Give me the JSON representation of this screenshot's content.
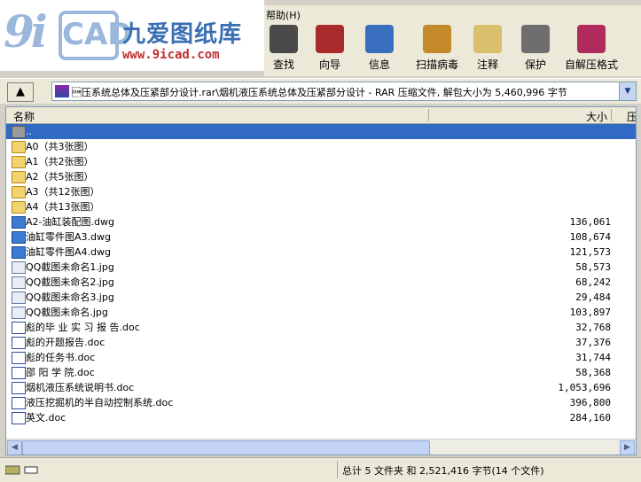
{
  "menu": {
    "help": "帮助(H)"
  },
  "logo": {
    "big": "9i",
    "cad": "CAD",
    "cn": "九爱图纸库",
    "url": "www.9icad.com"
  },
  "toolbar": [
    {
      "label": "查找",
      "icon": "binoculars-icon",
      "color": "#4a4a4a"
    },
    {
      "label": "向导",
      "icon": "wizard-icon",
      "color": "#a82a2a"
    },
    {
      "label": "信息",
      "icon": "info-icon",
      "color": "#3a6fc0"
    },
    {
      "label": "扫描病毒",
      "icon": "virus-scan-icon",
      "color": "#c48a2a"
    },
    {
      "label": "注释",
      "icon": "comment-icon",
      "color": "#d9c06e"
    },
    {
      "label": "保护",
      "icon": "shield-icon",
      "color": "#6e6e6e"
    },
    {
      "label": "自解压格式",
      "icon": "sfx-archive-icon",
      "color": "#b02a5c"
    }
  ],
  "address": {
    "path": "\u001a压系统总体及压紧部分设计.rar\\烟机液压系统总体及压紧部分设计 - RAR 压缩文件, 解包大小为 5,460,996 字节"
  },
  "columns": {
    "name": "名称",
    "size": "大小",
    "compressed": "压"
  },
  "files": [
    {
      "name": "..",
      "size": "",
      "type": "updir",
      "selected": true
    },
    {
      "name": "A0（共3张图）",
      "size": "",
      "type": "folder"
    },
    {
      "name": "A1（共2张图）",
      "size": "",
      "type": "folder"
    },
    {
      "name": "A2（共5张图）",
      "size": "",
      "type": "folder"
    },
    {
      "name": "A3（共12张图）",
      "size": "",
      "type": "folder"
    },
    {
      "name": "A4（共13张图）",
      "size": "",
      "type": "folder"
    },
    {
      "name": "A2-油缸装配图.dwg",
      "size": "136,061",
      "type": "dwg"
    },
    {
      "name": "油缸零件图A3.dwg",
      "size": "108,674",
      "type": "dwg"
    },
    {
      "name": "油缸零件图A4.dwg",
      "size": "121,573",
      "type": "dwg"
    },
    {
      "name": "QQ截图未命名1.jpg",
      "size": "58,573",
      "type": "jpg"
    },
    {
      "name": "QQ截图未命名2.jpg",
      "size": "68,242",
      "type": "jpg"
    },
    {
      "name": "QQ截图未命名3.jpg",
      "size": "29,484",
      "type": "jpg"
    },
    {
      "name": "QQ截图未命名.jpg",
      "size": "103,897",
      "type": "jpg"
    },
    {
      "name": "彪的毕 业 实 习 报 告.doc",
      "size": "32,768",
      "type": "doc"
    },
    {
      "name": "彪的开题报告.doc",
      "size": "37,376",
      "type": "doc"
    },
    {
      "name": "彪的任务书.doc",
      "size": "31,744",
      "type": "doc"
    },
    {
      "name": "邵 阳 学 院.doc",
      "size": "58,368",
      "type": "doc"
    },
    {
      "name": "烟机液压系统说明书.doc",
      "size": "1,053,696",
      "type": "doc"
    },
    {
      "name": "液压挖掘机的半自动控制系统.doc",
      "size": "396,800",
      "type": "doc"
    },
    {
      "name": "英文.doc",
      "size": "284,160",
      "type": "doc"
    }
  ],
  "status": {
    "summary": "总计 5 文件夹 和 2,521,416 字节(14 个文件)"
  }
}
